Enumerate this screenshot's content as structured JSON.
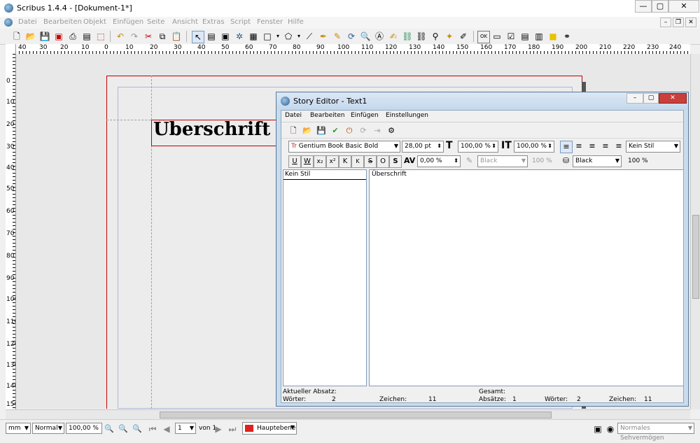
{
  "window": {
    "title": "Scribus 1.4.4 - [Dokument-1*]",
    "minimize": "—",
    "maximize": "▢",
    "close": "✕"
  },
  "menu": [
    "Datei",
    "Bearbeiten",
    "Objekt",
    "Einfügen",
    "Seite",
    "Ansicht",
    "Extras",
    "Script",
    "Fenster",
    "Hilfe"
  ],
  "rulers": {
    "horizontal": [
      "40",
      "30",
      "20",
      "10",
      "0",
      "10",
      "20",
      "30",
      "40",
      "50",
      "60",
      "70",
      "80",
      "90",
      "100",
      "110",
      "120",
      "130",
      "140",
      "150",
      "160",
      "170",
      "180",
      "190",
      "200",
      "210",
      "220",
      "230",
      "240",
      "250"
    ],
    "vertical": [
      "0",
      "10",
      "20",
      "30",
      "40",
      "50",
      "60",
      "70",
      "80",
      "90",
      "100",
      "110",
      "120",
      "130",
      "140",
      "150",
      "160"
    ]
  },
  "canvas": {
    "text_frame_content": "Überschrift"
  },
  "status": {
    "unit": "mm",
    "mode": "Normal",
    "zoom": "100,00 %",
    "page": "1",
    "page_of": "von 1",
    "layer": "Hauptebene",
    "view_mode": "Normales Sehvermögen"
  },
  "story_editor": {
    "title": "Story Editor - Text1",
    "menu": [
      "Datei",
      "Bearbeiten",
      "Einfügen",
      "Einstellungen"
    ],
    "font": "Gentium Book Basic Bold",
    "font_size": "28,00 pt",
    "scale_h": "100,00 %",
    "scale_v": "100,00 %",
    "para_style": "Kein Stil",
    "tracking": "0,00 %",
    "stroke_color": "Black",
    "stroke_shade": "100 %",
    "fill_color": "Black",
    "fill_shade": "100 %",
    "style_column_item": "Kein Stil",
    "text": "Überschrift",
    "footer": {
      "current_label": "Aktueller Absatz:",
      "words_label": "Wörter:",
      "words_cur": "2",
      "chars_label": "Zeichen:",
      "chars_cur": "11",
      "total_label": "Gesamt:",
      "paras_label": "Absätze:",
      "paras_total": "1",
      "words_label2": "Wörter:",
      "words_total": "2",
      "chars_label2": "Zeichen:",
      "chars_total": "11"
    }
  },
  "colors": {
    "accent": "#2a5d8c",
    "layer": "#e02020",
    "frame_border": "#c00000"
  }
}
